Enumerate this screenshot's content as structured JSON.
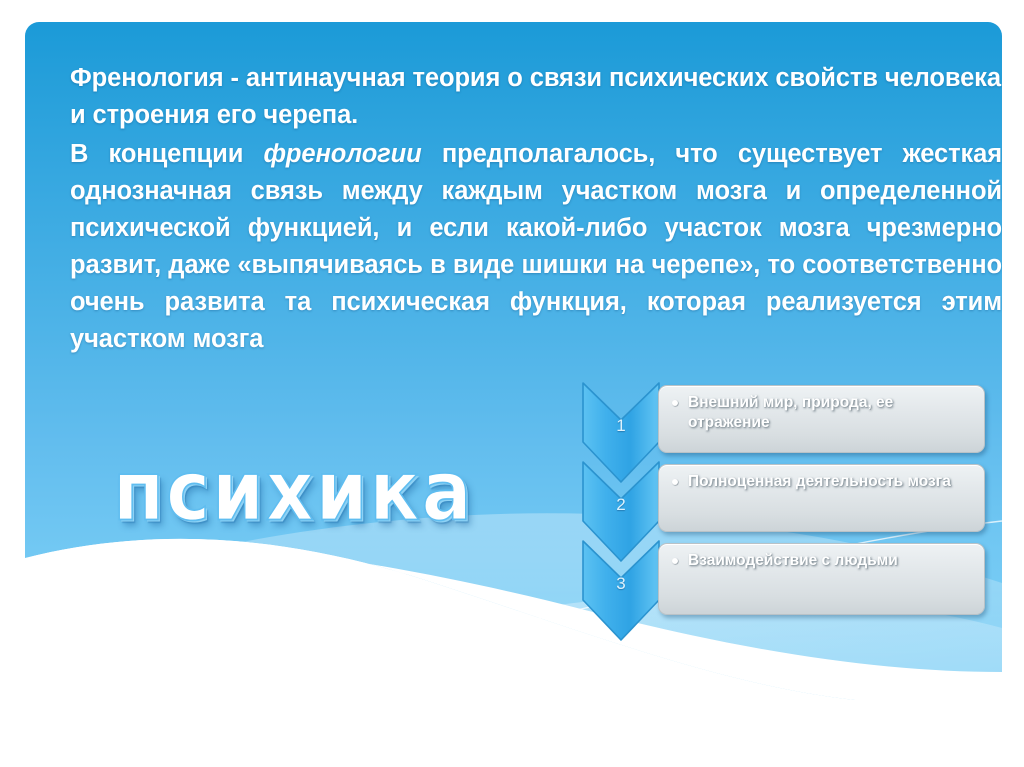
{
  "slide": {
    "background_outer": "#ffffff",
    "panel_gradient_top": "#1b9ad8",
    "panel_gradient_bottom": "#7ccef5"
  },
  "body_text": {
    "paragraph_1": "Френология - антинаучная теория о связи психических свойств человека и строения его черепа.",
    "paragraph_2_before": "В концепции ",
    "paragraph_2_italic": "френологии",
    "paragraph_2_after": " предполагалось, что существует жесткая однозначная связь между каждым участком мозга и определенной психической функцией, и если какой-либо участок мозга чрезмерно развит, даже «выпячиваясь в виде шишки на черепе», то соответственно очень развита та психическая функция, которая реализуется этим участком мозга"
  },
  "wordart": {
    "text": "психика",
    "fill_color": "#ffffff",
    "outline_color": "#5fbdf0"
  },
  "chevron_list": {
    "items": [
      {
        "number": "1",
        "label": "Внешний мир, природа, ее отражение"
      },
      {
        "number": "2",
        "label": "Полноценная деятельность мозга"
      },
      {
        "number": "3",
        "label": "Взаимодействие с людьми"
      }
    ],
    "chevron_color": "#3aa7e6",
    "callout_color": "#dde3e7"
  }
}
